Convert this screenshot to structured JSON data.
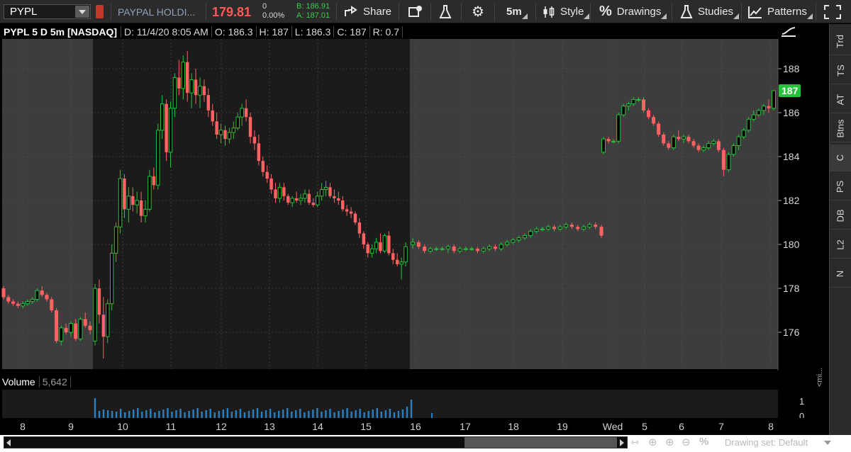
{
  "toolbar": {
    "symbol": "PYPL",
    "description": "PAYPAL HOLDI...",
    "last_price": "179.81",
    "net_change": "0",
    "pct_change": "0.00%",
    "bid": "B: 186.91",
    "ask": "A: 187.01",
    "share_label": "Share",
    "timeframe_label": "5m",
    "style_label": "Style",
    "drawings_label": "Drawings",
    "studies_label": "Studies",
    "patterns_label": "Patterns",
    "icons": [
      "share-icon",
      "alert-icon",
      "flask-icon",
      "gear-icon",
      "candle-icon",
      "percent-icon",
      "studies-icon",
      "patterns-icon",
      "fullscreen-icon"
    ]
  },
  "chart_header": {
    "title": "PYPL 5 D 5m [NASDAQ]",
    "date": "D: 11/4/20 8:05 AM",
    "open": "O: 186.3",
    "high": "H: 187",
    "low": "L: 186.3",
    "close": "C: 187",
    "range": "R: 0.7"
  },
  "price_axis": {
    "ticks": [
      "188",
      "186",
      "184",
      "182",
      "180",
      "178",
      "176"
    ],
    "last_marker": "187",
    "marker_color": "#26c33a"
  },
  "volume": {
    "label": "Volume",
    "value": "5,642",
    "axis_ticks": [
      "1",
      "0"
    ]
  },
  "time_axis": {
    "labels": [
      "8",
      "9",
      "10",
      "11",
      "12",
      "13",
      "14",
      "15",
      "16",
      "17",
      "18",
      "19",
      "Wed",
      "5",
      "6",
      "7",
      "8"
    ]
  },
  "right_panel": {
    "items": [
      "Trd",
      "TS",
      "AT",
      "Btns",
      "C",
      "PS",
      "DB",
      "L2",
      "N"
    ],
    "active": "C",
    "mini_label": "<mi..."
  },
  "bottom_bar": {
    "drawing_set": "Drawing set: Default"
  },
  "colors": {
    "up": "#26c33a",
    "down": "#ff6262",
    "volume": "#2a7fc0",
    "session_regular": "#1b1b1b",
    "session_extended": "#3d3d3d"
  },
  "chart_data": {
    "type": "candlestick",
    "title": "PYPL 5 D 5m [NASDAQ]",
    "ylim": [
      174.5,
      189.5
    ],
    "x_labels": [
      "8",
      "9",
      "10",
      "11",
      "12",
      "13",
      "14",
      "15",
      "16",
      "17",
      "18",
      "19",
      "Wed",
      "5",
      "6",
      "7",
      "8"
    ],
    "grid": true,
    "segments": [
      {
        "session": "pre-market",
        "ohlc": [
          [
            178.0,
            178.1,
            177.5,
            177.6
          ],
          [
            177.6,
            177.7,
            177.3,
            177.4
          ],
          [
            177.4,
            177.5,
            177.2,
            177.3
          ],
          [
            177.3,
            177.4,
            177.1,
            177.2
          ],
          [
            177.2,
            177.4,
            177.1,
            177.3
          ],
          [
            177.3,
            177.5,
            177.2,
            177.4
          ],
          [
            177.4,
            177.6,
            177.3,
            177.5
          ],
          [
            177.5,
            178.0,
            177.4,
            177.9
          ],
          [
            177.9,
            178.1,
            177.6,
            177.7
          ],
          [
            177.7,
            177.8,
            177.4,
            177.5
          ],
          [
            177.5,
            177.6,
            176.9,
            177.0
          ],
          [
            177.0,
            177.1,
            175.5,
            175.6
          ],
          [
            175.6,
            176.3,
            175.4,
            176.2
          ],
          [
            176.2,
            176.4,
            175.9,
            176.0
          ],
          [
            176.0,
            176.5,
            175.8,
            176.4
          ],
          [
            176.4,
            176.6,
            175.6,
            175.7
          ],
          [
            175.7,
            176.7,
            175.6,
            176.6
          ],
          [
            176.6,
            176.9,
            176.2,
            176.3
          ],
          [
            176.3,
            176.5,
            175.9,
            176.1
          ]
        ]
      },
      {
        "session": "regular",
        "ohlc": [
          [
            175.6,
            178.2,
            175.4,
            178.0
          ],
          [
            178.0,
            178.4,
            176.4,
            176.8
          ],
          [
            176.8,
            177.6,
            174.8,
            175.8
          ],
          [
            175.8,
            177.5,
            175.5,
            177.3
          ],
          [
            177.3,
            180.0,
            177.0,
            179.6
          ],
          [
            179.6,
            181.0,
            179.2,
            180.8
          ],
          [
            180.8,
            183.4,
            180.5,
            183.0
          ],
          [
            183.0,
            183.2,
            181.2,
            181.6
          ],
          [
            181.6,
            182.6,
            181.0,
            182.2
          ],
          [
            182.2,
            182.6,
            181.5,
            181.8
          ],
          [
            181.8,
            182.4,
            181.4,
            182.0
          ],
          [
            182.0,
            182.4,
            181.0,
            181.3
          ],
          [
            181.3,
            182.0,
            181.0,
            181.6
          ],
          [
            181.6,
            183.4,
            181.5,
            183.1
          ],
          [
            183.1,
            183.5,
            182.5,
            182.7
          ],
          [
            182.7,
            185.5,
            182.5,
            185.2
          ],
          [
            185.2,
            186.8,
            184.8,
            186.4
          ],
          [
            186.4,
            186.6,
            183.8,
            184.2
          ],
          [
            184.2,
            186.5,
            183.5,
            186.2
          ],
          [
            186.2,
            187.8,
            185.8,
            187.6
          ],
          [
            187.6,
            188.4,
            186.8,
            187.1
          ],
          [
            187.1,
            188.6,
            186.6,
            188.3
          ],
          [
            188.3,
            188.8,
            186.5,
            186.9
          ],
          [
            186.9,
            187.8,
            186.2,
            187.5
          ],
          [
            187.5,
            188.0,
            186.4,
            186.8
          ],
          [
            186.8,
            187.6,
            186.2,
            187.2
          ],
          [
            187.2,
            187.5,
            186.5,
            186.8
          ],
          [
            186.8,
            187.1,
            185.8,
            186.1
          ],
          [
            186.1,
            186.4,
            185.4,
            185.6
          ],
          [
            185.6,
            186.0,
            184.8,
            185.0
          ],
          [
            185.0,
            185.5,
            184.6,
            185.2
          ],
          [
            185.2,
            185.4,
            184.5,
            184.8
          ],
          [
            184.8,
            185.3,
            184.6,
            185.1
          ],
          [
            185.1,
            185.6,
            184.8,
            185.3
          ],
          [
            185.3,
            186.0,
            185.2,
            185.8
          ],
          [
            185.8,
            186.4,
            185.4,
            186.2
          ],
          [
            186.2,
            186.6,
            185.6,
            185.8
          ],
          [
            185.8,
            186.0,
            184.6,
            184.9
          ],
          [
            184.9,
            185.2,
            184.3,
            184.6
          ],
          [
            184.6,
            185.0,
            183.6,
            183.8
          ],
          [
            183.8,
            184.0,
            183.1,
            183.3
          ],
          [
            183.3,
            183.6,
            182.8,
            183.0
          ],
          [
            183.0,
            183.2,
            182.3,
            182.5
          ],
          [
            182.5,
            182.8,
            181.9,
            182.1
          ],
          [
            182.1,
            182.8,
            181.9,
            182.6
          ],
          [
            182.6,
            182.8,
            182.0,
            182.2
          ],
          [
            182.2,
            182.3,
            181.8,
            181.9
          ],
          [
            181.9,
            182.2,
            181.7,
            182.1
          ],
          [
            182.1,
            182.4,
            181.9,
            182.0
          ],
          [
            182.0,
            182.3,
            181.8,
            182.1
          ],
          [
            182.1,
            182.5,
            181.9,
            182.3
          ],
          [
            182.3,
            182.5,
            181.8,
            181.9
          ],
          [
            181.9,
            182.1,
            181.7,
            181.8
          ],
          [
            181.8,
            182.4,
            181.7,
            182.2
          ],
          [
            182.2,
            182.8,
            182.0,
            182.5
          ],
          [
            182.5,
            182.9,
            182.2,
            182.6
          ],
          [
            182.6,
            182.8,
            182.1,
            182.2
          ],
          [
            182.2,
            182.5,
            181.9,
            182.1
          ],
          [
            182.1,
            182.4,
            181.8,
            182.0
          ],
          [
            182.0,
            182.2,
            181.5,
            181.6
          ],
          [
            181.6,
            181.8,
            181.3,
            181.5
          ],
          [
            181.5,
            181.7,
            181.2,
            181.4
          ],
          [
            181.4,
            181.5,
            180.9,
            181.0
          ],
          [
            181.0,
            181.2,
            180.3,
            180.5
          ],
          [
            180.5,
            180.6,
            179.8,
            180.0
          ],
          [
            180.0,
            180.1,
            179.4,
            179.6
          ],
          [
            179.6,
            180.0,
            179.4,
            179.8
          ],
          [
            179.8,
            180.3,
            179.6,
            180.1
          ],
          [
            180.1,
            180.5,
            179.6,
            179.7
          ],
          [
            179.7,
            180.5,
            179.6,
            180.4
          ],
          [
            180.4,
            180.6,
            179.5,
            179.6
          ],
          [
            179.6,
            179.8,
            179.1,
            179.3
          ],
          [
            179.3,
            179.6,
            179.0,
            179.1
          ],
          [
            179.1,
            179.4,
            178.4,
            179.2
          ],
          [
            179.2,
            180.1,
            179.0,
            179.9
          ]
        ]
      },
      {
        "session": "after-hours",
        "ohlc": [
          [
            180.0,
            180.3,
            179.8,
            180.1
          ],
          [
            180.1,
            180.2,
            179.8,
            179.9
          ],
          [
            179.9,
            180.0,
            179.6,
            179.7
          ],
          [
            179.7,
            179.9,
            179.6,
            179.8
          ],
          [
            179.8,
            179.9,
            179.7,
            179.8
          ],
          [
            179.8,
            179.9,
            179.7,
            179.8
          ],
          [
            179.8,
            180.0,
            179.6,
            179.9
          ],
          [
            179.9,
            180.0,
            179.6,
            179.7
          ],
          [
            179.7,
            179.9,
            179.6,
            179.8
          ],
          [
            179.8,
            179.9,
            179.7,
            179.8
          ],
          [
            179.8,
            179.9,
            179.7,
            179.8
          ],
          [
            179.8,
            179.9,
            179.6,
            179.7
          ],
          [
            179.7,
            179.9,
            179.6,
            179.8
          ],
          [
            179.8,
            180.0,
            179.7,
            179.9
          ],
          [
            179.9,
            180.0,
            179.7,
            179.8
          ],
          [
            179.8,
            180.1,
            179.7,
            180.0
          ],
          [
            180.0,
            180.2,
            179.9,
            180.1
          ],
          [
            180.1,
            180.3,
            180.0,
            180.2
          ],
          [
            180.2,
            180.4,
            180.1,
            180.3
          ],
          [
            180.3,
            180.5,
            180.2,
            180.4
          ],
          [
            180.4,
            180.7,
            180.3,
            180.6
          ],
          [
            180.6,
            180.8,
            180.5,
            180.7
          ],
          [
            180.7,
            180.8,
            180.6,
            180.7
          ],
          [
            180.7,
            180.9,
            180.6,
            180.8
          ],
          [
            180.8,
            180.9,
            180.6,
            180.7
          ],
          [
            180.7,
            180.9,
            180.6,
            180.8
          ],
          [
            180.8,
            181.0,
            180.7,
            180.9
          ],
          [
            180.9,
            181.0,
            180.7,
            180.8
          ],
          [
            180.8,
            180.9,
            180.6,
            180.7
          ],
          [
            180.7,
            180.9,
            180.6,
            180.8
          ],
          [
            180.8,
            181.0,
            180.7,
            180.9
          ],
          [
            180.9,
            181.0,
            180.7,
            180.8
          ],
          [
            180.8,
            180.9,
            180.3,
            180.4
          ]
        ]
      },
      {
        "session": "pre-market-wed",
        "ohlc": [
          [
            184.2,
            184.9,
            184.1,
            184.8
          ],
          [
            184.8,
            184.9,
            184.6,
            184.7
          ],
          [
            184.7,
            184.8,
            184.6,
            184.7
          ],
          [
            184.7,
            186.0,
            184.6,
            185.9
          ],
          [
            185.9,
            186.4,
            185.8,
            186.3
          ],
          [
            186.3,
            186.5,
            186.1,
            186.4
          ],
          [
            186.4,
            186.7,
            186.3,
            186.6
          ],
          [
            186.6,
            186.7,
            186.5,
            186.6
          ],
          [
            186.6,
            186.7,
            186.0,
            186.1
          ],
          [
            186.1,
            186.2,
            185.7,
            185.8
          ],
          [
            185.8,
            185.9,
            185.4,
            185.5
          ],
          [
            185.5,
            185.6,
            184.9,
            185.0
          ],
          [
            185.0,
            185.1,
            184.5,
            184.6
          ],
          [
            184.6,
            184.7,
            184.3,
            184.4
          ],
          [
            184.4,
            185.0,
            184.3,
            184.9
          ],
          [
            184.9,
            185.2,
            184.7,
            184.8
          ],
          [
            184.8,
            185.0,
            184.6,
            184.9
          ],
          [
            184.9,
            185.0,
            184.6,
            184.7
          ],
          [
            184.7,
            184.8,
            184.4,
            184.5
          ],
          [
            184.5,
            184.6,
            184.2,
            184.3
          ],
          [
            184.3,
            184.5,
            184.2,
            184.4
          ],
          [
            184.4,
            184.7,
            184.3,
            184.6
          ],
          [
            184.6,
            184.8,
            184.5,
            184.7
          ],
          [
            184.7,
            184.8,
            184.2,
            184.3
          ],
          [
            184.3,
            184.4,
            183.1,
            183.4
          ],
          [
            183.4,
            184.2,
            183.3,
            184.1
          ],
          [
            184.1,
            184.6,
            184.0,
            184.5
          ],
          [
            184.5,
            185.0,
            184.3,
            184.9
          ],
          [
            184.9,
            185.3,
            184.8,
            185.2
          ],
          [
            185.2,
            185.8,
            185.1,
            185.7
          ],
          [
            185.7,
            186.1,
            185.6,
            185.9
          ],
          [
            185.9,
            186.2,
            185.8,
            186.1
          ],
          [
            186.1,
            186.4,
            185.9,
            186.3
          ],
          [
            186.3,
            186.6,
            186.0,
            186.2
          ],
          [
            186.2,
            187.0,
            186.1,
            187.0
          ]
        ]
      }
    ],
    "volume_scale": [
      0,
      1
    ]
  }
}
